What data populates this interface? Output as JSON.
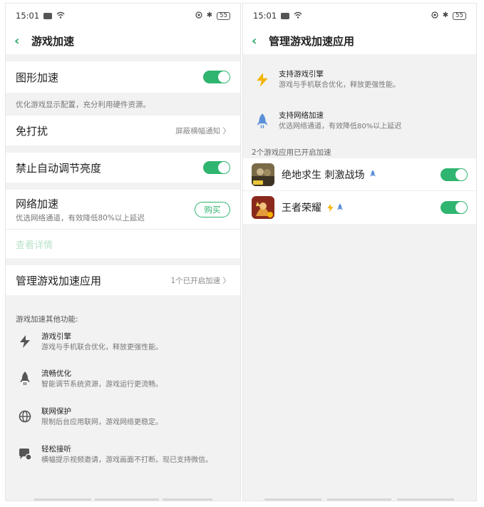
{
  "status": {
    "time": "15:01",
    "battery": "55"
  },
  "left": {
    "title": "游戏加速",
    "graphics": {
      "label": "图形加速",
      "desc": "优化游戏显示配置，充分利用硬件资源。"
    },
    "dnd": {
      "label": "免打扰",
      "value": "屏蔽横幅通知"
    },
    "brightness": {
      "label": "禁止自动调节亮度"
    },
    "network": {
      "label": "网络加速",
      "desc": "优选网络通道，有效降低80%以上延迟",
      "buy": "购买",
      "details": "查看详情"
    },
    "manage": {
      "label": "管理游戏加速应用",
      "value": "1个已开启加速"
    },
    "other_title": "游戏加速其他功能:",
    "features": [
      {
        "icon": "lightning-icon",
        "title": "游戏引擎",
        "desc": "游戏与手机联合优化，释放更强性能。"
      },
      {
        "icon": "rocket-icon",
        "title": "流畅优化",
        "desc": "智能调节系统资源，游戏运行更流畅。"
      },
      {
        "icon": "globe-icon",
        "title": "联网保护",
        "desc": "限制后台应用联网，游戏网络更稳定。"
      },
      {
        "icon": "chat-bubble-icon",
        "title": "轻松接听",
        "desc": "横幅提示视频邀请，游戏画面不打断。现已支持微信。"
      }
    ]
  },
  "right": {
    "title": "管理游戏加速应用",
    "legend": [
      {
        "icon": "lightning-icon",
        "title": "支持游戏引擎",
        "desc": "游戏与手机联合优化，释放更强性能。"
      },
      {
        "icon": "rocket-icon",
        "title": "支持网络加速",
        "desc": "优选网络通道，有效降低80%以上延迟"
      }
    ],
    "count_label": "2个游戏应用已开启加速",
    "games": [
      {
        "name": "绝地求生 刺激战场"
      },
      {
        "name": "王者荣耀"
      }
    ]
  },
  "colors": {
    "accent": "#2fb56f",
    "lightning": "#f4b400",
    "rocket": "#5b8fd8"
  }
}
